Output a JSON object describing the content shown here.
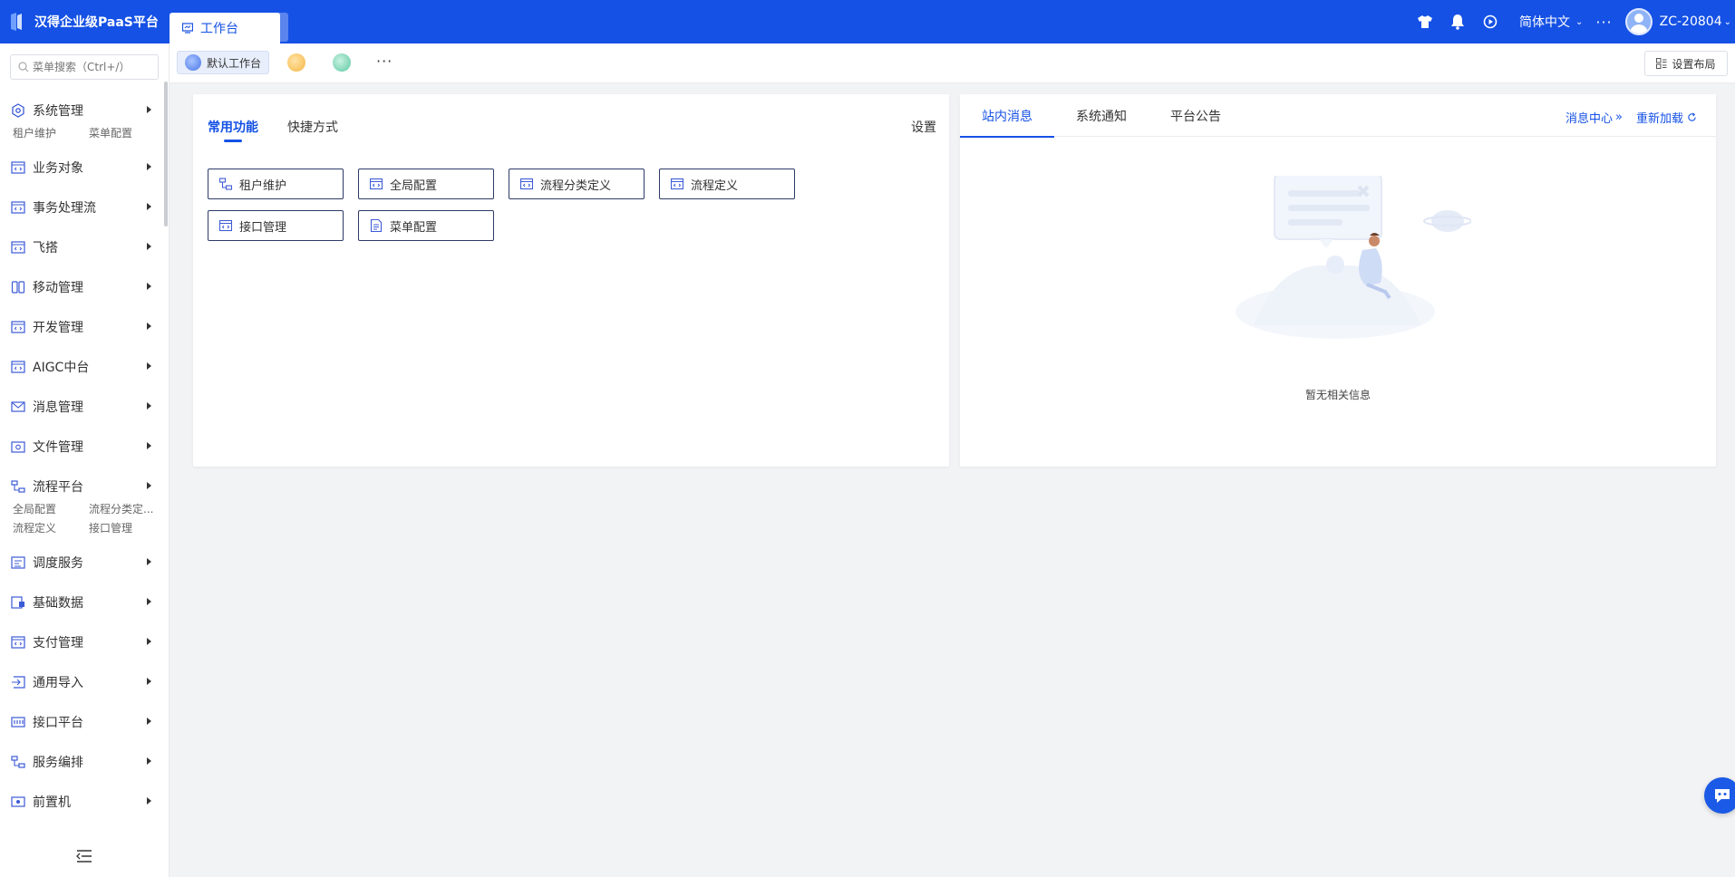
{
  "app": {
    "title": "汉得企业级PaaS平台",
    "active_tab": "工作台",
    "add_tab": "+"
  },
  "header": {
    "language": "简体中文",
    "more": "···",
    "user": "ZC-20804"
  },
  "sidebar": {
    "search_placeholder": "菜单搜索（Ctrl+/）",
    "items": [
      {
        "label": "系统管理",
        "icon": "cube-icon",
        "sub": [
          "租户维护",
          "菜单配置"
        ]
      },
      {
        "label": "业务对象",
        "icon": "code-window-icon"
      },
      {
        "label": "事务处理流",
        "icon": "code-window-icon"
      },
      {
        "label": "飞搭",
        "icon": "code-window-icon"
      },
      {
        "label": "移动管理",
        "icon": "mobile-icon"
      },
      {
        "label": "开发管理",
        "icon": "code-window-icon"
      },
      {
        "label": "AIGC中台",
        "icon": "code-window-icon"
      },
      {
        "label": "消息管理",
        "icon": "message-icon"
      },
      {
        "label": "文件管理",
        "icon": "folder-icon"
      },
      {
        "label": "流程平台",
        "icon": "flow-icon",
        "sub": [
          "全局配置",
          "流程分类定...",
          "流程定义",
          "接口管理"
        ]
      },
      {
        "label": "调度服务",
        "icon": "schedule-icon"
      },
      {
        "label": "基础数据",
        "icon": "data-icon"
      },
      {
        "label": "支付管理",
        "icon": "code-window-icon"
      },
      {
        "label": "通用导入",
        "icon": "import-icon"
      },
      {
        "label": "接口平台",
        "icon": "api-icon"
      },
      {
        "label": "服务编排",
        "icon": "flow-icon"
      },
      {
        "label": "前置机",
        "icon": "server-icon"
      }
    ]
  },
  "subbar": {
    "default_workbench": "默认工作台",
    "more": "···",
    "layout_button": "设置布局"
  },
  "left_panel": {
    "tabs": [
      "常用功能",
      "快捷方式"
    ],
    "setting": "设置",
    "functions": [
      "租户维护",
      "全局配置",
      "流程分类定义",
      "流程定义",
      "接口管理",
      "菜单配置"
    ]
  },
  "right_panel": {
    "tabs": [
      "站内消息",
      "系统通知",
      "平台公告"
    ],
    "message_center": "消息中心",
    "reload": "重新加载",
    "empty_text": "暂无相关信息"
  },
  "colors": {
    "brand": "#1551e5",
    "background": "#f2f3f5"
  }
}
